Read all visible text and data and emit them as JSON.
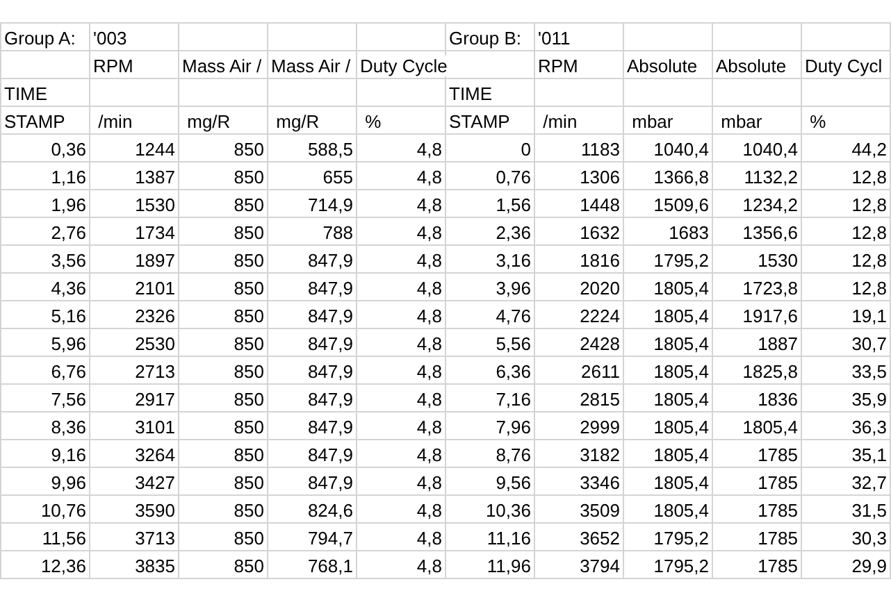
{
  "sheet": {
    "rows": [
      {
        "kind": "header",
        "cells": [
          "Group A:",
          "'003",
          null,
          null,
          null,
          "Group B:",
          "'011",
          null,
          null,
          null
        ]
      },
      {
        "kind": "header",
        "cells": [
          null,
          "RPM",
          "Mass Air /",
          "Mass Air /",
          "Duty Cycle",
          null,
          "RPM",
          "Absolute",
          "Absolute",
          "Duty Cycl"
        ]
      },
      {
        "kind": "header",
        "cells": [
          "TIME",
          null,
          null,
          null,
          null,
          "TIME",
          null,
          null,
          null,
          null
        ]
      },
      {
        "kind": "header",
        "cells": [
          "STAMP",
          " /min",
          " mg/R",
          " mg/R",
          " %",
          "STAMP",
          " /min",
          " mbar",
          " mbar",
          " %"
        ]
      },
      {
        "kind": "data",
        "cells": [
          "0,36",
          "1244",
          "850",
          "588,5",
          "4,8",
          "0",
          "1183",
          "1040,4",
          "1040,4",
          "44,2"
        ]
      },
      {
        "kind": "data",
        "cells": [
          "1,16",
          "1387",
          "850",
          "655",
          "4,8",
          "0,76",
          "1306",
          "1366,8",
          "1132,2",
          "12,8"
        ]
      },
      {
        "kind": "data",
        "cells": [
          "1,96",
          "1530",
          "850",
          "714,9",
          "4,8",
          "1,56",
          "1448",
          "1509,6",
          "1234,2",
          "12,8"
        ]
      },
      {
        "kind": "data",
        "cells": [
          "2,76",
          "1734",
          "850",
          "788",
          "4,8",
          "2,36",
          "1632",
          "1683",
          "1356,6",
          "12,8"
        ]
      },
      {
        "kind": "data",
        "cells": [
          "3,56",
          "1897",
          "850",
          "847,9",
          "4,8",
          "3,16",
          "1816",
          "1795,2",
          "1530",
          "12,8"
        ]
      },
      {
        "kind": "data",
        "cells": [
          "4,36",
          "2101",
          "850",
          "847,9",
          "4,8",
          "3,96",
          "2020",
          "1805,4",
          "1723,8",
          "12,8"
        ]
      },
      {
        "kind": "data",
        "cells": [
          "5,16",
          "2326",
          "850",
          "847,9",
          "4,8",
          "4,76",
          "2224",
          "1805,4",
          "1917,6",
          "19,1"
        ]
      },
      {
        "kind": "data",
        "cells": [
          "5,96",
          "2530",
          "850",
          "847,9",
          "4,8",
          "5,56",
          "2428",
          "1805,4",
          "1887",
          "30,7"
        ]
      },
      {
        "kind": "data",
        "cells": [
          "6,76",
          "2713",
          "850",
          "847,9",
          "4,8",
          "6,36",
          "2611",
          "1805,4",
          "1825,8",
          "33,5"
        ]
      },
      {
        "kind": "data",
        "cells": [
          "7,56",
          "2917",
          "850",
          "847,9",
          "4,8",
          "7,16",
          "2815",
          "1805,4",
          "1836",
          "35,9"
        ]
      },
      {
        "kind": "data",
        "cells": [
          "8,36",
          "3101",
          "850",
          "847,9",
          "4,8",
          "7,96",
          "2999",
          "1805,4",
          "1805,4",
          "36,3"
        ]
      },
      {
        "kind": "data",
        "cells": [
          "9,16",
          "3264",
          "850",
          "847,9",
          "4,8",
          "8,76",
          "3182",
          "1805,4",
          "1785",
          "35,1"
        ]
      },
      {
        "kind": "data",
        "cells": [
          "9,96",
          "3427",
          "850",
          "847,9",
          "4,8",
          "9,56",
          "3346",
          "1805,4",
          "1785",
          "32,7"
        ]
      },
      {
        "kind": "data",
        "cells": [
          "10,76",
          "3590",
          "850",
          "824,6",
          "4,8",
          "10,36",
          "3509",
          "1805,4",
          "1785",
          "31,5"
        ]
      },
      {
        "kind": "data",
        "cells": [
          "11,56",
          "3713",
          "850",
          "794,7",
          "4,8",
          "11,16",
          "3652",
          "1795,2",
          "1785",
          "30,3"
        ]
      },
      {
        "kind": "data",
        "cells": [
          "12,36",
          "3835",
          "850",
          "768,1",
          "4,8",
          "11,96",
          "3794",
          "1795,2",
          "1785",
          "29,9"
        ]
      }
    ]
  }
}
